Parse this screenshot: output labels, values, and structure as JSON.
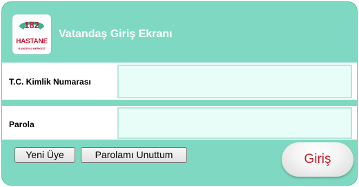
{
  "logo": {
    "number": "182",
    "name": "HASTANE",
    "tagline": "RANDEVU MERKEZİ"
  },
  "title": "Vatandaş Giriş Ekranı",
  "fields": {
    "tc": {
      "label": "T.C. Kimlik Numarası",
      "value": ""
    },
    "password": {
      "label": "Parola",
      "value": ""
    }
  },
  "buttons": {
    "register": "Yeni Üye",
    "forgot": "Parolamı Unuttum",
    "login": "Giriş"
  },
  "colors": {
    "panel": "#7fd9c2",
    "input_bg": "#e9fdf8",
    "brand_red": "#c8102e",
    "login_text": "#c41e2a"
  }
}
